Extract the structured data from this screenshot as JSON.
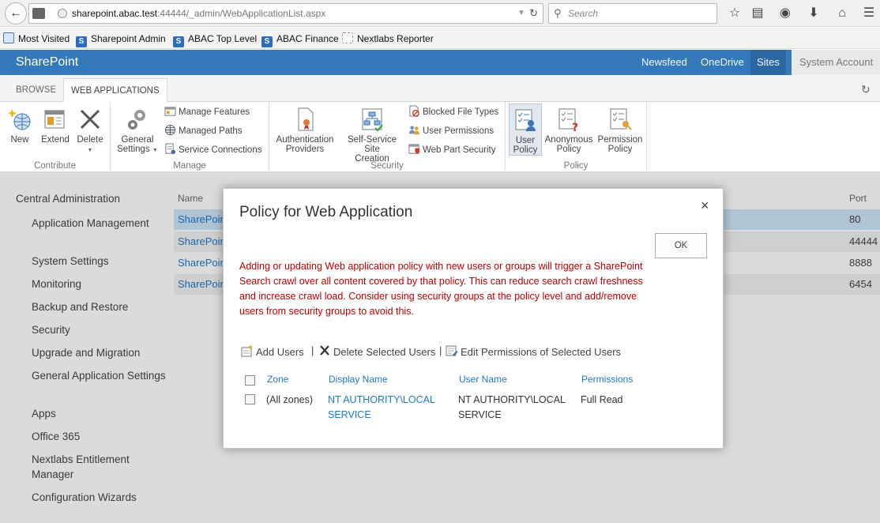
{
  "browser": {
    "url_host": "sharepoint.abac.test",
    "url_rest": ":44444/_admin/WebApplicationList.aspx",
    "search_placeholder": "Search",
    "bookmarks": [
      "Most Visited",
      "Sharepoint Admin",
      "ABAC Top Level",
      "ABAC Finance",
      "Nextlabs Reporter"
    ]
  },
  "suite": {
    "title": "SharePoint",
    "links": [
      "Newsfeed",
      "OneDrive",
      "Sites"
    ],
    "account": "System Account"
  },
  "ribbon": {
    "tabs": [
      "BROWSE",
      "WEB APPLICATIONS"
    ],
    "contribute": {
      "label": "Contribute",
      "new": "New",
      "extend": "Extend",
      "delete": "Delete"
    },
    "manage": {
      "label": "Manage",
      "general_settings_1": "General",
      "general_settings_2": "Settings",
      "manage_features": "Manage Features",
      "managed_paths": "Managed Paths",
      "service_connections": "Service Connections"
    },
    "security": {
      "label": "Security",
      "auth_providers_1": "Authentication",
      "auth_providers_2": "Providers",
      "self_service_1": "Self-Service Site",
      "self_service_2": "Creation",
      "blocked_file_types": "Blocked File Types",
      "user_permissions": "User Permissions",
      "web_part_security": "Web Part Security"
    },
    "policy": {
      "label": "Policy",
      "user_policy_1": "User",
      "user_policy_2": "Policy",
      "anon_policy_1": "Anonymous",
      "anon_policy_2": "Policy",
      "perm_policy_1": "Permission",
      "perm_policy_2": "Policy"
    }
  },
  "nav": {
    "root": "Central Administration",
    "items": [
      "Application Management",
      "System Settings",
      "Monitoring",
      "Backup and Restore",
      "Security",
      "Upgrade and Migration",
      "General Application Settings",
      "Apps",
      "Office 365",
      "Nextlabs Entitlement Manager",
      "Configuration Wizards"
    ]
  },
  "web_apps": {
    "col_name": "Name",
    "col_port": "Port",
    "rows": [
      {
        "name": "SharePoint",
        "port": "80"
      },
      {
        "name": "SharePoint",
        "port": "44444"
      },
      {
        "name": "SharePoint",
        "port": "8888"
      },
      {
        "name": "SharePoint",
        "port": "6454"
      }
    ]
  },
  "dialog": {
    "title": "Policy for Web Application",
    "close": "×",
    "ok": "OK",
    "warning": "Adding or updating Web application policy with new users or groups will trigger a SharePoint Search crawl over all content covered by that policy. This can reduce search crawl freshness and increase crawl load. Consider using security groups at the policy level and add/remove users from security groups to avoid this.",
    "toolbar": {
      "add_users": "Add Users",
      "delete_users": "Delete Selected Users",
      "edit_permissions": "Edit Permissions of Selected Users",
      "separator": "|"
    },
    "table": {
      "headers": [
        "Zone",
        "Display Name",
        "User Name",
        "Permissions"
      ],
      "rows": [
        {
          "zone": "(All zones)",
          "display_name_1": "NT AUTHORITY\\LOCAL",
          "display_name_2": "SERVICE",
          "user_name_1": "NT AUTHORITY\\LOCAL",
          "user_name_2": "SERVICE",
          "permissions": "Full Read"
        }
      ]
    }
  }
}
